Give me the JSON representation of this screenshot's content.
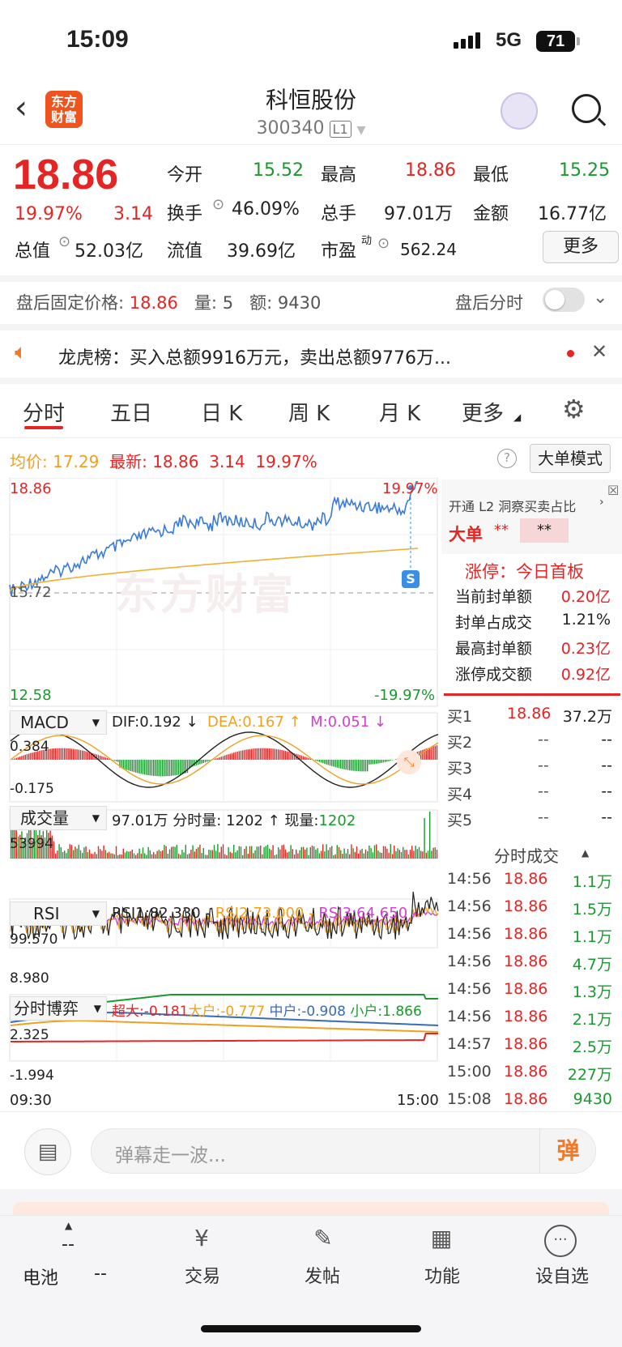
{
  "status": {
    "time": "15:09",
    "network": "5G",
    "battery": "71"
  },
  "header": {
    "title": "科恒股份",
    "code": "300340",
    "level": "L1",
    "logo": "东方\n财富"
  },
  "quote": {
    "price": "18.86",
    "pct": "19.97%",
    "chg": "3.14",
    "open_label": "今开",
    "open": "15.52",
    "high_label": "最高",
    "high": "18.86",
    "low_label": "最低",
    "low": "15.25",
    "turnover_label": "换手",
    "turnover": "46.09%",
    "volume_label": "总手",
    "volume": "97.01万",
    "amount_label": "金额",
    "amount": "16.77亿",
    "mktcap_label": "总值",
    "mktcap": "52.03亿",
    "float_label": "流值",
    "float": "39.69亿",
    "pe_label": "市盈",
    "pe_sup": "动",
    "pe": "562.24",
    "more": "更多"
  },
  "post": {
    "label": "盘后固定价格:",
    "price": "18.86",
    "vol_label": "量:",
    "vol": "5",
    "amt_label": "额:",
    "amt": "9430",
    "toggle_label": "盘后分时"
  },
  "news": "龙虎榜：买入总额9916万元，卖出总额9776万...",
  "tabs": [
    "分时",
    "五日",
    "日 K",
    "周 K",
    "月 K",
    "更多"
  ],
  "avg": {
    "label": "均价:",
    "value": "17.29",
    "latest_label": "最新:",
    "latest": "18.86",
    "chg": "3.14",
    "pct": "19.97%",
    "mode": "大单模式"
  },
  "chart": {
    "top_left": "18.86",
    "top_right": "19.97%",
    "mid": "15.72",
    "bottom_left": "12.58",
    "bottom_right": "-19.97%",
    "watermark": "东方财富",
    "s_marker": "S"
  },
  "macd": {
    "name": "MACD",
    "dif": "DIF:0.192 ↓",
    "dea": "DEA:0.167 ↑",
    "m": "M:0.051 ↓",
    "top": "0.384",
    "bottom": "-0.175"
  },
  "vol": {
    "name": "成交量",
    "total": "97.01万",
    "fs_label": "分时量: 1202 ↑",
    "now_label": "现量:",
    "now": "1202",
    "top": "53994"
  },
  "rsi": {
    "name": "RSI",
    "r1": "RSI1:82.330 -",
    "r2": "RSI2:73.000 -",
    "r3": "RSI3:64.650 -",
    "top": "99.570",
    "bottom": "8.980"
  },
  "game": {
    "name": "分时博弈",
    "a": "超大:-0.181",
    "b": "大户:-0.777",
    "c": "中户:-0.908",
    "d": "小户:1.866",
    "top": "2.325",
    "bottom": "-1.994",
    "t0": "09:30",
    "t1": "15:00"
  },
  "side": {
    "l2": "开通 L2 洞察买卖占比",
    "dadan": "大单",
    "stars1": "**",
    "stars2": "**",
    "zt_title": "涨停：今日首板",
    "rows": [
      {
        "k": "当前封单额",
        "v": "0.20亿",
        "c": "#e52424"
      },
      {
        "k": "封单占成交",
        "v": "1.21%",
        "c": "#222"
      },
      {
        "k": "最高封单额",
        "v": "0.23亿",
        "c": "#e52424"
      },
      {
        "k": "涨停成交额",
        "v": "0.92亿",
        "c": "#e52424"
      }
    ],
    "buys": [
      {
        "k": "买1",
        "p": "18.86",
        "v": "37.2万"
      },
      {
        "k": "买2",
        "p": "--",
        "v": "--"
      },
      {
        "k": "买3",
        "p": "--",
        "v": "--"
      },
      {
        "k": "买4",
        "p": "--",
        "v": "--"
      },
      {
        "k": "买5",
        "p": "--",
        "v": "--"
      }
    ],
    "ticks_title": "分时成交",
    "ticks": [
      {
        "t": "14:56",
        "p": "18.86",
        "v": "1.1万"
      },
      {
        "t": "14:56",
        "p": "18.86",
        "v": "1.5万"
      },
      {
        "t": "14:56",
        "p": "18.86",
        "v": "1.1万"
      },
      {
        "t": "14:56",
        "p": "18.86",
        "v": "4.7万"
      },
      {
        "t": "14:56",
        "p": "18.86",
        "v": "1.3万"
      },
      {
        "t": "14:56",
        "p": "18.86",
        "v": "2.1万"
      },
      {
        "t": "14:57",
        "p": "18.86",
        "v": "2.5万"
      },
      {
        "t": "15:00",
        "p": "18.86",
        "v": "227万"
      },
      {
        "t": "15:08",
        "p": "18.86",
        "v": "9430"
      }
    ]
  },
  "comment": {
    "placeholder": "弹幕走一波...",
    "btn": "弹"
  },
  "nav": {
    "battery_label": "电池",
    "dash1": "--",
    "dash2": "--",
    "items": [
      "交易",
      "发帖",
      "功能",
      "设自选"
    ]
  }
}
